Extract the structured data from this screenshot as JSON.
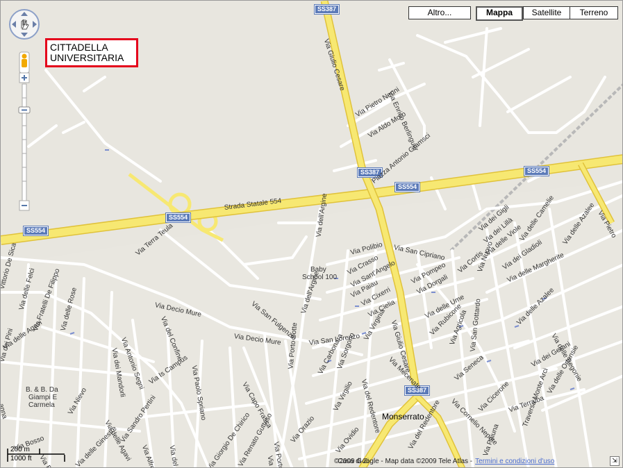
{
  "map_type_buttons": [
    {
      "label": "Altro..."
    },
    {
      "label": "Mappa",
      "active": true
    },
    {
      "label": "Satellite"
    },
    {
      "label": "Terreno"
    }
  ],
  "callout": {
    "line1": "CITTADELLA",
    "line2": "UNIVERSITARIA"
  },
  "shields": {
    "ss387_top": "SS387",
    "ss387_mid": "SS387",
    "ss387_low": "SS387",
    "ss554_left": "SS554",
    "ss554_center": "SS554",
    "ss554_mid": "SS554",
    "ss554_right": "SS554"
  },
  "labels": {
    "via_giulio_cesare_n": "Via Giulio Cesare",
    "via_giulio_cesare_s": "Via Giulio Cesare",
    "strada_statale_554": "Strada Statale 554",
    "via_enrico_berlinguer": "Via Enrico Berlinguer",
    "via_pietro_nenni": "Via Pietro Nenni",
    "via_aldo_moro": "Via Aldo Moro",
    "piazza_antonio_gramsci": "Piazza Antonio Gramsci",
    "via_terra_teula": "Via Terra Teula",
    "via_dell_argine_n": "Via dell'Argine",
    "via_dell_argine_s": "Via dell'Argine",
    "baby_school_1": "Baby",
    "baby_school_2": "School 100",
    "via_polibio": "Via Polibio",
    "via_san_cipriano": "Via San Cipriano",
    "via_crasso": "Via Crasso",
    "via_sant_angelo": "Via Sant'Angelo",
    "via_paiau": "Via Paiau",
    "via_cixerri": "Via Cixerri",
    "via_cielia": "Via Cielia",
    "via_pompeo": "Via Pompeo",
    "via_dorgali": "Via Dorgali",
    "via_delle_ume": "Via delle Ume",
    "via_rubicone": "Via Rubicone",
    "via_agricola": "Via Agricola",
    "via_nuovo": "Via Nuovo",
    "via_cortis": "Via Cortis",
    "via_dei_gigli": "Via dei Gigli",
    "via_dei_lilla": "Via dei Lillà",
    "via_delle_viole": "Via delle Viole",
    "via_dei_gladioli": "Via dei Gladioli",
    "via_delle_camelie": "Via delle Camelie",
    "via_delle_margherite": "Via delle Margherite",
    "via_delle_azalee_ne": "Via delle Azalee",
    "via_pietro_e": "Via Pietro",
    "via_delle_azalee": "Via delle Azalee",
    "via_delle_begonie": "Via delle Begonie",
    "via_dei_gerani": "Via dei Gerani",
    "via_delle_ortensie": "Via delle Ortensie",
    "via_san_gottardo": "Via San Gottardo",
    "via_seneca": "Via Seneca",
    "via_cicerone": "Via Cicerone",
    "via_terralba": "Via Terralba",
    "traversa_monte_arci": "Traversa Monte Arci",
    "via_corneliu_nepote": "Via Cornelio Nepote",
    "via_paiuna": "Via Paiuna",
    "via_mecenate": "Via Mecenate",
    "via_san_fulgenzio": "Via San Fulgenzio",
    "via_decio_mure_1": "Via Decio Mure",
    "via_decio_mure_2": "Via Decio Mure",
    "via_san_lorenzo": "Via San Lorenzo",
    "via_virginia": "Via Virginia",
    "via_carbonara": "Via Carbonara",
    "via_sorgono": "Via Sorgono",
    "via_del_redentore_1": "Via del Redentore",
    "via_del_redentore_2": "Via del Redentore",
    "via_porto_botte": "Via Porto Botte",
    "via_virgilio": "Via Virgilio",
    "via_ovidio": "Via Ovidio",
    "via_orazio": "Via Orazio",
    "via_capo_frasca": "Via Capo Frasca",
    "via_porto_pino": "Via Porto Pino",
    "via_capo": "Via Capo",
    "via_giorgio_de_chirico": "Via Giorgio De Chirico",
    "via_renato_guttuso": "Via Renato Guttuso",
    "via_paolo_spriano": "Via Paolo Spriano",
    "via_is_campus": "Via Is Campus",
    "via_del_confine": "Via del Confine",
    "via_dei_mandorli": "Via dei Mandorli",
    "via_antonio_segni": "Via Antonio Segni",
    "via_sandro_pertini": "Via Sandro Pertini",
    "via_alfredino": "Via Alfredino",
    "via_del_mo": "Via del Mo",
    "via_delle_ginestre": "Via delle Ginestre",
    "via_della_agavi_s": "Via delle Agavi",
    "via_delle_agavi_w": "Via delle Agavi",
    "via_nievo": "Via Nievo",
    "via_fratelli_de_filippo": "Via Fratelli De Filippo",
    "via_delle_felci": "Via delle Felci",
    "via_delle_rose": "Via delle Rose",
    "via_vittorio_de_sica": "Vittorio De Sica",
    "via_dei_pini": "Via dei Pini",
    "bb_1": "B. & B. Da",
    "bb_2": "Giampi E",
    "bb_3": "Carmela",
    "via_bosso": "Via Bosso",
    "via_barrac": "Via Barrac",
    "vanna": "anna",
    "casa_di": "Casa di Zi",
    "monserrato": "Monserrato"
  },
  "scale": {
    "metric": "200 m",
    "imperial": "1000 ft"
  },
  "footer": {
    "copyright": "©2009 Google - Map data ©2009 Tele Atlas -",
    "terms": "Termini e condizioni d'uso"
  },
  "colors": {
    "background": "#e8e6df",
    "minor_road": "#ffffff",
    "major_road": "#f7e872",
    "major_road_edge": "#e5c844",
    "shield": "#5b7ab8",
    "callout_border": "#e4001b",
    "railway": "#b5b5b5"
  }
}
